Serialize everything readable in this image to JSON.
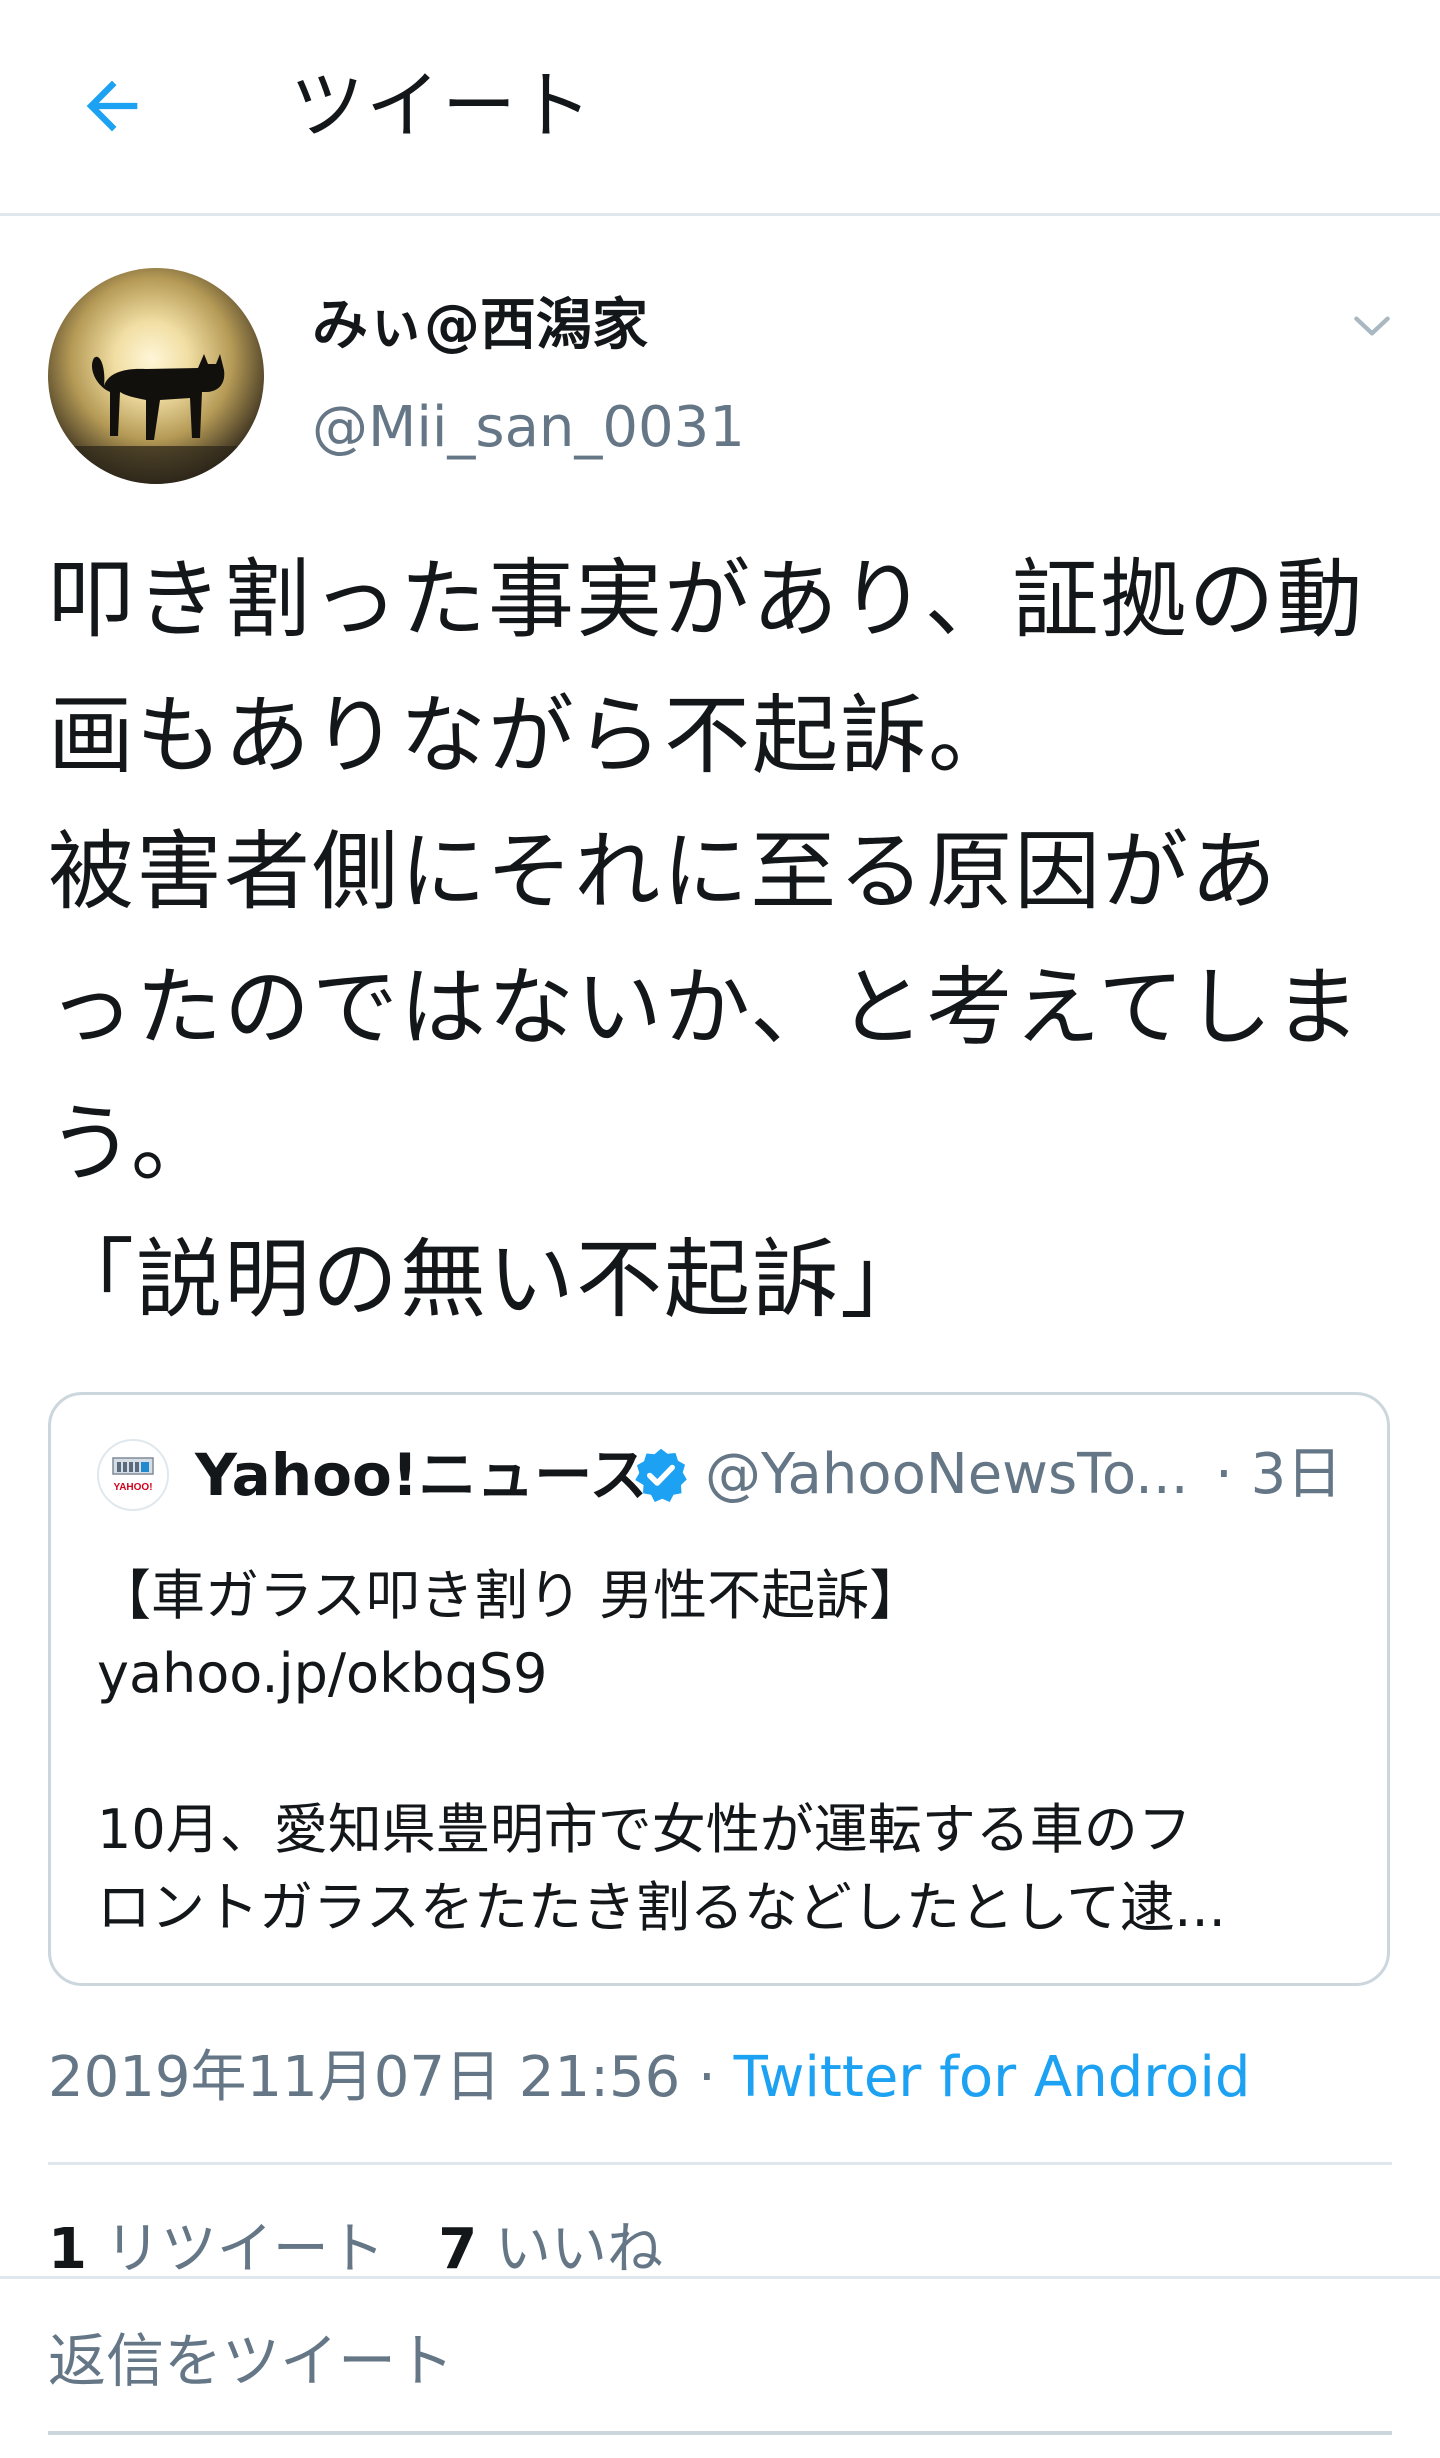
{
  "header": {
    "title": "ツイート"
  },
  "tweet": {
    "display_name": "みぃ@西潟家",
    "handle": "@Mii_san_0031",
    "lines": [
      "叩き割った事実があり、証拠の動",
      "画もありながら不起訴。",
      "被害者側にそれに至る原因があ",
      "ったのではないか、と考えてしま",
      "う。",
      "「説明の無い不起訴」"
    ]
  },
  "quote": {
    "name": "Yahoo!ニュース",
    "handle": "@YahooNewsTo...",
    "time": "· 3日",
    "lines": [
      "【車ガラス叩き割り 男性不起訴】",
      "yahoo.jp/okbqS9",
      "",
      "10月、愛知県豊明市で女性が運転する車のフ",
      "ロントガラスをたたき割るなどしたとして逮..."
    ],
    "avatar_text": "YAHOO!"
  },
  "meta": {
    "timestamp": "2019年11月07日 21:56 · ",
    "source": "Twitter for Android"
  },
  "stats": {
    "retweet_count": "1",
    "retweet_label": "リツイート",
    "like_count": "7",
    "like_label": "いいね"
  },
  "reply": {
    "placeholder": "返信をツイート"
  },
  "colors": {
    "accent": "#1da1f2",
    "secondary_text": "#657786",
    "border": "#e1e8ed"
  },
  "icons": {
    "back": "back-arrow-icon",
    "caret": "chevron-down-icon",
    "verified": "verified-badge-icon"
  }
}
